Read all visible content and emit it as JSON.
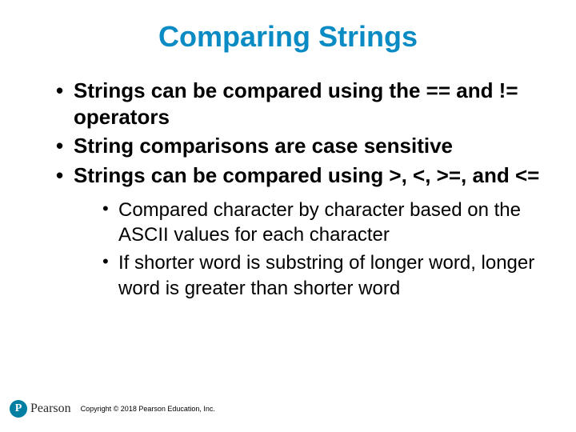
{
  "title": "Comparing Strings",
  "bullets": [
    "Strings can be compared using the == and != operators",
    "String comparisons are case sensitive",
    "Strings can be compared using >, <, >=, and <="
  ],
  "subbullets": [
    "Compared character by character based on the ASCII values for each character",
    "If shorter word is substring of longer word, longer word is greater than shorter word"
  ],
  "logo": {
    "mark": "P",
    "word": "Pearson"
  },
  "copyright": "Copyright © 2018 Pearson Education, Inc."
}
